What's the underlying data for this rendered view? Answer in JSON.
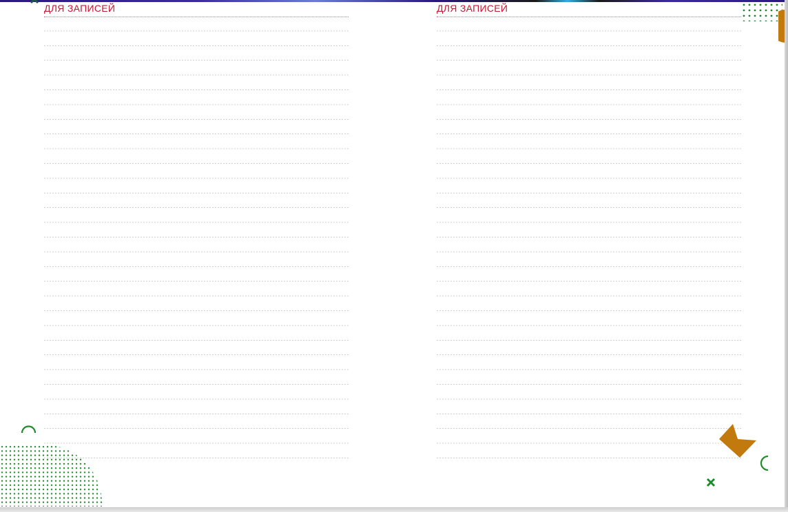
{
  "left_page": {
    "title": "ДЛЯ ЗАПИСЕЙ"
  },
  "right_page": {
    "title": "ДЛЯ ЗАПИСЕЙ"
  },
  "colors": {
    "title": "#c0182f",
    "rule": "#cfcfcf",
    "accent_green": "#1f8a2a",
    "accent_orange": "#c27a0e"
  },
  "decorations": [
    "dot-grid-pattern",
    "arc-icon",
    "cross-icon",
    "kite-shape",
    "half-circle-shape"
  ]
}
